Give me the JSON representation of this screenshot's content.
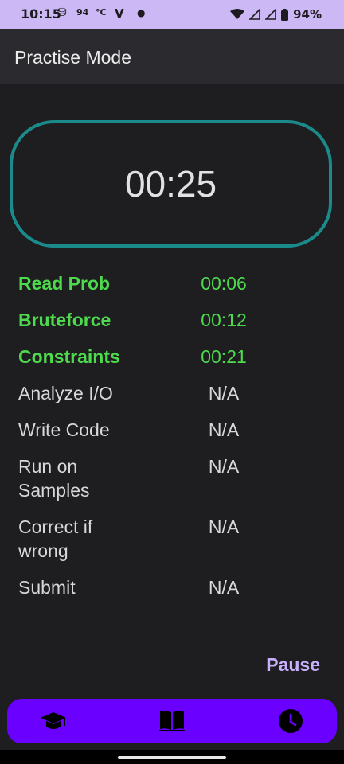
{
  "status_bar": {
    "time": "10:15",
    "temp": "94",
    "unit": "°C",
    "carrier": "V",
    "battery": "94%"
  },
  "app_bar": {
    "title": "Practise Mode"
  },
  "timer": {
    "value": "00:25",
    "border_color": "#1a8a8a"
  },
  "steps": [
    {
      "label": "Read Prob",
      "time": "00:06",
      "done": true
    },
    {
      "label": "Bruteforce",
      "time": "00:12",
      "done": true
    },
    {
      "label": "Constraints",
      "time": "00:21",
      "done": true
    },
    {
      "label": "Analyze I/O",
      "time": "N/A",
      "done": false
    },
    {
      "label": "Write Code",
      "time": "N/A",
      "done": false
    },
    {
      "label": "Run on Samples",
      "time": "N/A",
      "done": false
    },
    {
      "label": "Correct if wrong",
      "time": "N/A",
      "done": false
    },
    {
      "label": "Submit",
      "time": "N/A",
      "done": false
    }
  ],
  "actions": {
    "pause_label": "Pause"
  },
  "bottom_nav": {
    "items": [
      {
        "icon": "graduation-cap-icon"
      },
      {
        "icon": "book-icon"
      },
      {
        "icon": "clock-icon"
      }
    ],
    "color": "#6a00ff"
  },
  "colors": {
    "done": "#4ddb4d",
    "pending": "#d8d8d8",
    "accent": "#c9b0ff"
  }
}
